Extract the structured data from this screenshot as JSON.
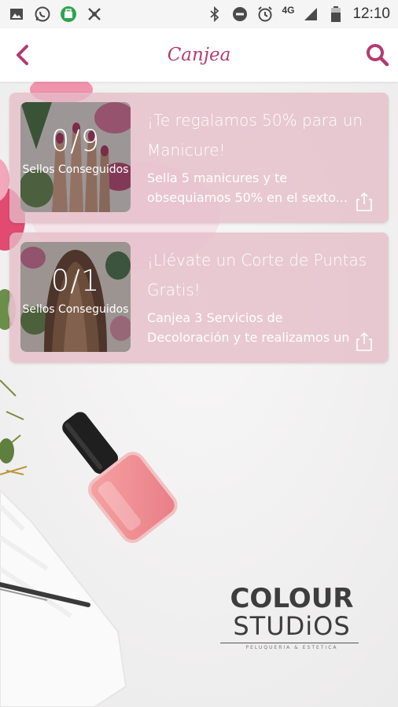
{
  "status_bar": {
    "time": "12:10",
    "network": "4G",
    "left_icons": [
      "image-icon",
      "whatsapp-icon",
      "store-icon",
      "tool-icon"
    ],
    "right_icons": [
      "bluetooth-icon",
      "do-not-disturb-icon",
      "alarm-icon",
      "signal-icon",
      "battery-icon"
    ]
  },
  "appbar": {
    "title": "Canjea",
    "back_icon": "chevron-left-icon",
    "search_icon": "search-icon",
    "accent_color": "#b23b73"
  },
  "cards": [
    {
      "count": "0/9",
      "count_label": "Sellos Conseguidos",
      "title": "¡Te regalamos 50% para un Manicure!",
      "description": "Sella 5 manicures y te obsequiamos 50% en el sexto..."
    },
    {
      "count": "0/1",
      "count_label": "Sellos Conseguidos",
      "title": "¡Llévate un Corte de Puntas Gratis!",
      "description": "Canjea 3 Servicios de Decoloración y te realizamos un"
    }
  ],
  "brand": {
    "line1": "COLOUR",
    "line2": "STUDiOS",
    "line3": "PELUQUERIA & ESTETICA"
  }
}
